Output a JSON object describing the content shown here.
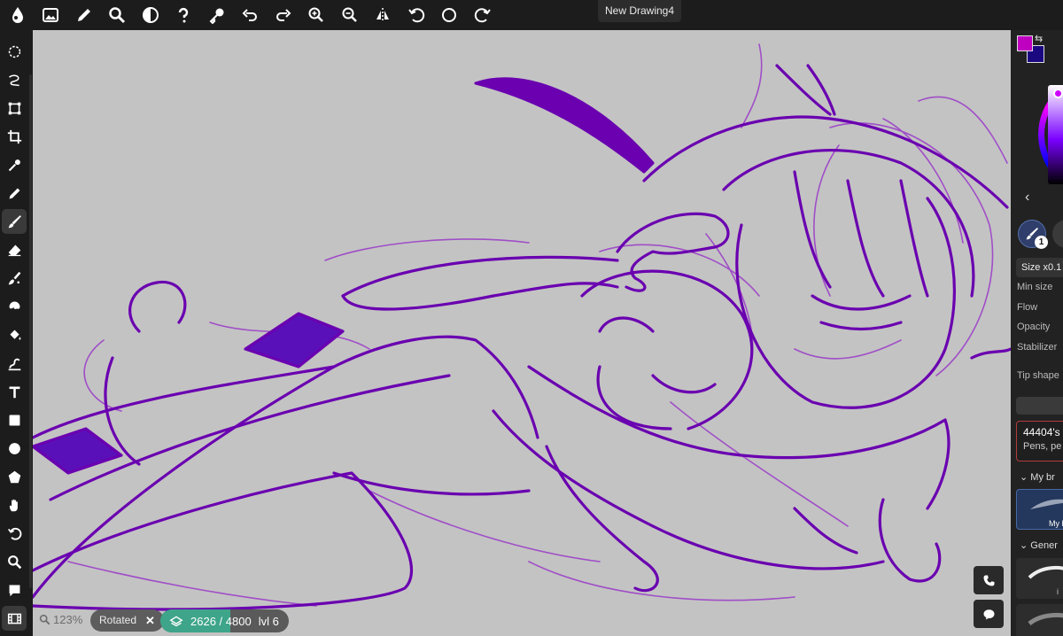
{
  "app": {
    "document_title": "New Drawing4"
  },
  "topbar": {
    "icons": [
      "app-logo-icon",
      "image-icon",
      "pencil-icon",
      "search-icon",
      "contrast-icon",
      "help-icon",
      "key-icon",
      "undo-icon",
      "redo-icon",
      "zoom-in-icon",
      "zoom-out-icon",
      "flip-icon",
      "rotate-left-icon",
      "reset-rotation-icon",
      "rotate-right-icon"
    ]
  },
  "lefttools": {
    "tools": [
      "lasso-select-icon",
      "freehand-select-icon",
      "transform-icon",
      "crop-icon",
      "eyedropper-icon",
      "pen-icon",
      "brush-icon",
      "eraser-icon",
      "blur-icon",
      "smudge-icon",
      "fill-bucket-icon",
      "liquify-icon",
      "text-icon",
      "rectangle-icon",
      "ellipse-icon",
      "shape-icon",
      "hand-icon",
      "rotate-tool-icon",
      "zoom-tool-icon",
      "comment-icon",
      "timeline-icon"
    ],
    "active": "brush-icon"
  },
  "status": {
    "zoom": "123%",
    "rotated_label": "Rotated",
    "rotated_close": "✕",
    "layers_count": "2626 / 4800",
    "layers_level": "lvl 6",
    "progress": 0.547
  },
  "colors": {
    "primary": "#c000c0",
    "secondary": "#1a0880",
    "stroke_main": "#6a00b0",
    "stroke_light": "#9a3ac8",
    "canvas_bg": "#c3c3c3",
    "accent_green": "#3ea58a"
  },
  "rightpanel": {
    "brush_badge": "1",
    "size_label": "Size x0.1",
    "min_size_label": "Min size",
    "flow_label": "Flow",
    "opacity_label": "Opacity",
    "stabilizer_label": "Stabilizer",
    "tip_shape_label": "Tip shape",
    "brushset_name": "44404's",
    "brushset_sub": "Pens, pe",
    "my_brushes_section": "My br",
    "my_brush_tile_caption": "My l",
    "general_section": "Gener",
    "general_tile_caption": "i"
  }
}
